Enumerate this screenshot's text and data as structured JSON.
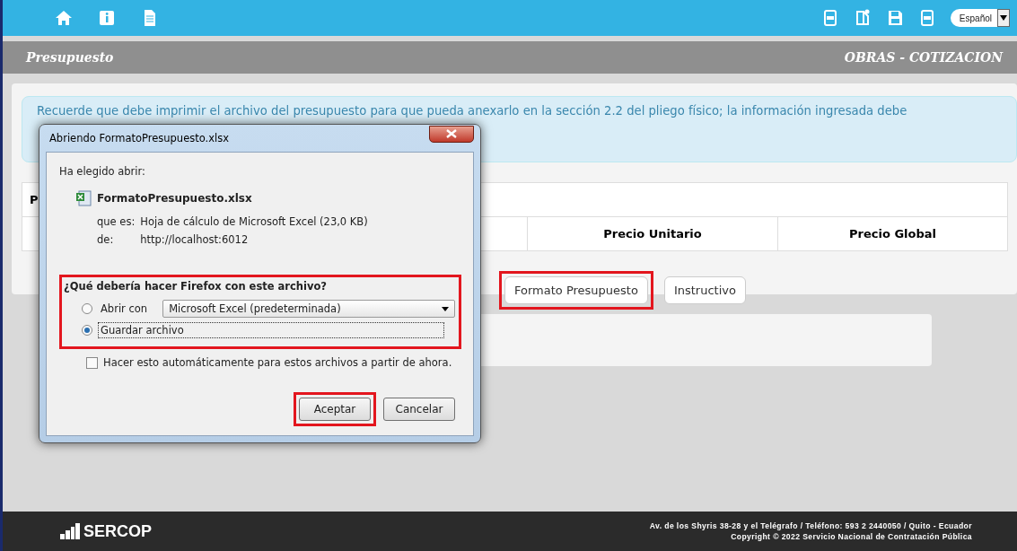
{
  "toolbar": {
    "language": "Español"
  },
  "header": {
    "title": "Presupuesto",
    "section": "OBRAS - COTIZACION"
  },
  "notice": {
    "text": "Recuerde que debe imprimir el archivo del presupuesto para que pueda anexarlo en la sección 2.2 del pliego físico; la información ingresada debe"
  },
  "table": {
    "row_1": "P",
    "columns": [
      "Precio Unitario",
      "Precio Global"
    ]
  },
  "buttons": [
    {
      "label": "Formato Presupuesto",
      "highlighted": true
    },
    {
      "label": "Instructivo",
      "highlighted": false
    }
  ],
  "dialog": {
    "title": "Abriendo FormatoPresupuesto.xlsx",
    "intro": "Ha elegido abrir:",
    "file_name": "FormatoPresupuesto.xlsx",
    "type_label": "que es:",
    "type_value": "Hoja de cálculo de Microsoft Excel (23,0 KB)",
    "from_label": "de:",
    "from_value": "http://localhost:6012",
    "question": "¿Qué debería hacer Firefox con este archivo?",
    "question_highlighted": true,
    "options": [
      {
        "kind": "dropdown",
        "label": "Abrir con",
        "value": "Microsoft Excel (predeterminada)",
        "selected": false
      },
      {
        "kind": "plain",
        "label": "Guardar archivo",
        "selected": true
      }
    ],
    "auto": {
      "label": "Hacer esto automáticamente para estos archivos a partir de ahora.",
      "checked": false
    },
    "buttons": [
      {
        "label": "Aceptar",
        "highlighted": true
      },
      {
        "label": "Cancelar",
        "highlighted": false
      }
    ]
  },
  "footer": {
    "logo": "SERCOP",
    "lines": [
      "Av. de los Shyris 38-28 y el Telégrafo / Teléfono: 593 2 2440050 / Quito - Ecuador",
      "Copyright © 2022 Servicio Nacional de Contratación Pública"
    ]
  }
}
